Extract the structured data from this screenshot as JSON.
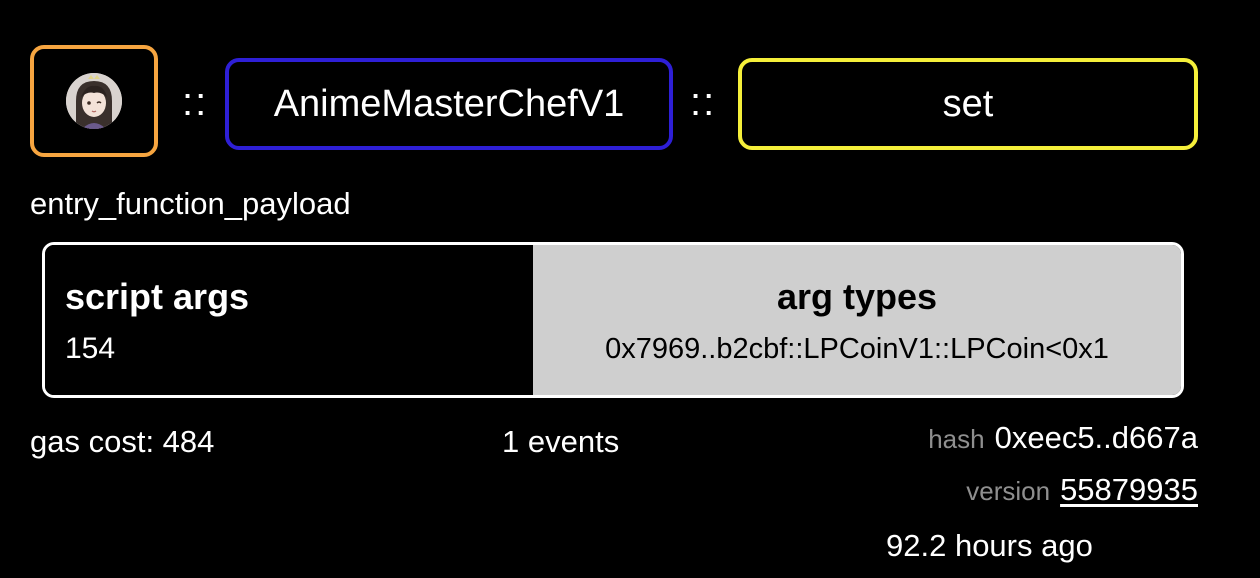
{
  "transaction": {
    "sender_avatar": "anime-avatar",
    "separator": "::",
    "module_name": "AnimeMasterChefV1",
    "function_name": "set",
    "payload_type": "entry_function_payload",
    "args_table": {
      "args_heading": "script args",
      "args_value": "154",
      "types_heading": "arg types",
      "types_value": "0x7969..b2cbf::LPCoinV1::LPCoin<0x1"
    },
    "gas_cost": "gas cost: 484",
    "events": "1 events",
    "hash_label": "hash",
    "hash_value": "0xeec5..d667a",
    "version_label": "version",
    "version_value": "55879935",
    "time_ago": "92.2 hours ago"
  },
  "colors": {
    "avatar_border": "#F6A540",
    "module_border": "#2E1FD6",
    "function_border": "#F5EF3A",
    "types_background": "#CFCFCF"
  }
}
